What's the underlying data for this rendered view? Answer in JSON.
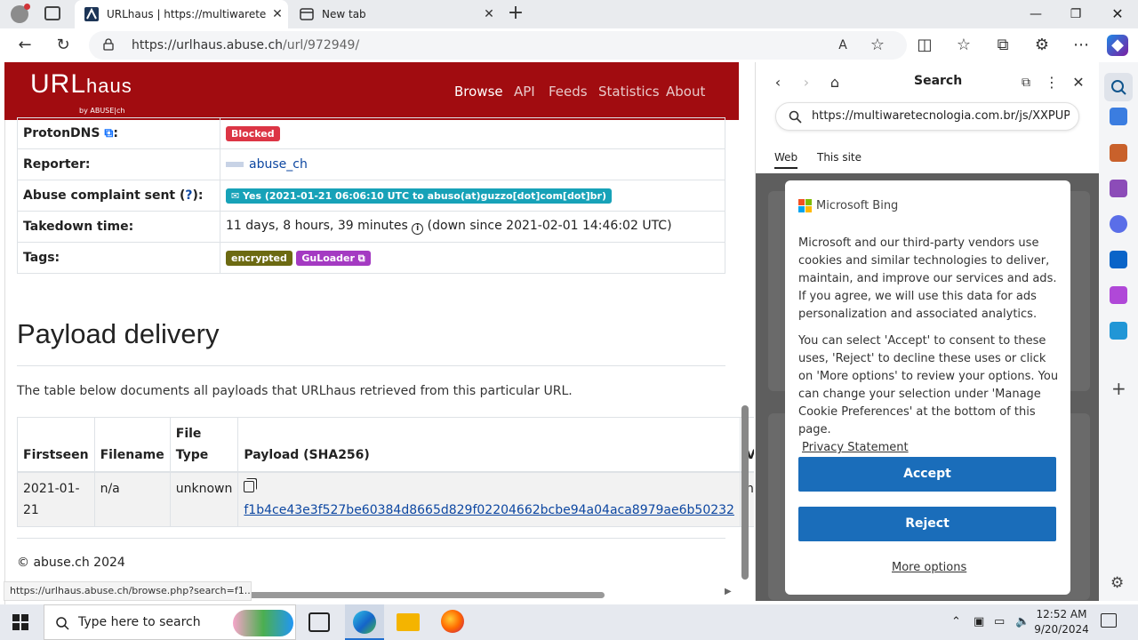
{
  "browser": {
    "tabs": [
      {
        "title": "URLhaus | https://multiwaretecn",
        "active": true
      },
      {
        "title": "New tab",
        "active": false
      }
    ],
    "address": {
      "host": "https://urlhaus.abuse.ch",
      "path": "/url/972949/"
    }
  },
  "site": {
    "logo_main": "URL",
    "logo_accent": "haus",
    "logo_sub": "by ABUSE|ch",
    "nav": [
      "Browse",
      "API",
      "Feeds",
      "Statistics",
      "About"
    ],
    "accent": "#a10c10"
  },
  "info_rows": [
    {
      "key": "ProtonDNS",
      "key_suffix": ":",
      "value": "Blocked"
    },
    {
      "key": "Reporter:",
      "value": "abuse_ch"
    },
    {
      "key": "Abuse complaint sent (",
      "key_q": "?",
      "key_end": "):",
      "value": "Yes (2021-01-21 06:06:10 UTC to abuso(at)guzzo[dot]com[dot]br)"
    },
    {
      "key": "Takedown time:",
      "value": "11 days, 8 hours, 39 minutes",
      "value_end": "(down since 2021-02-01 14:46:02 UTC)"
    },
    {
      "key": "Tags:",
      "tag1": "encrypted",
      "tag2": "GuLoader"
    }
  ],
  "payload": {
    "heading": "Payload delivery",
    "description": "The table below documents all payloads that URLhaus retrieved from this particular URL.",
    "columns": [
      "Firstseen",
      "Filename",
      "File Type",
      "Payload (SHA256)",
      "V"
    ],
    "row": {
      "firstseen": "2021-01-21",
      "filename": "n/a",
      "filetype": "unknown",
      "sha256": "f1b4ce43e3f527be60384d8665d829f02204662bcbe94a04aca8979ae6b50232",
      "v": "n/"
    }
  },
  "footer": "© abuse.ch 2024",
  "status_url": "https://urlhaus.abuse.ch/browse.php?search=f1...",
  "sidepane": {
    "title": "Search",
    "query": "https://multiwaretecnologia.com.br/js/XXPUP...",
    "tabs": [
      "Web",
      "This site"
    ],
    "cookie": {
      "brand": "Microsoft Bing",
      "para1": "Microsoft and our third-party vendors use cookies and similar technologies to deliver, maintain, and improve our services and ads. If you agree, we will use this data for ads personalization and associated analytics.",
      "para2": "You can select 'Accept' to consent to these uses, 'Reject' to decline these uses or click on 'More options' to review your options. You can change your selection under 'Manage Cookie Preferences' at the bottom of this page.",
      "privacy": "Privacy Statement",
      "accept": "Accept",
      "reject": "Reject",
      "more": "More options"
    }
  },
  "taskbar": {
    "search_placeholder": "Type here to search",
    "time": "12:52 AM",
    "date": "9/20/2024"
  }
}
